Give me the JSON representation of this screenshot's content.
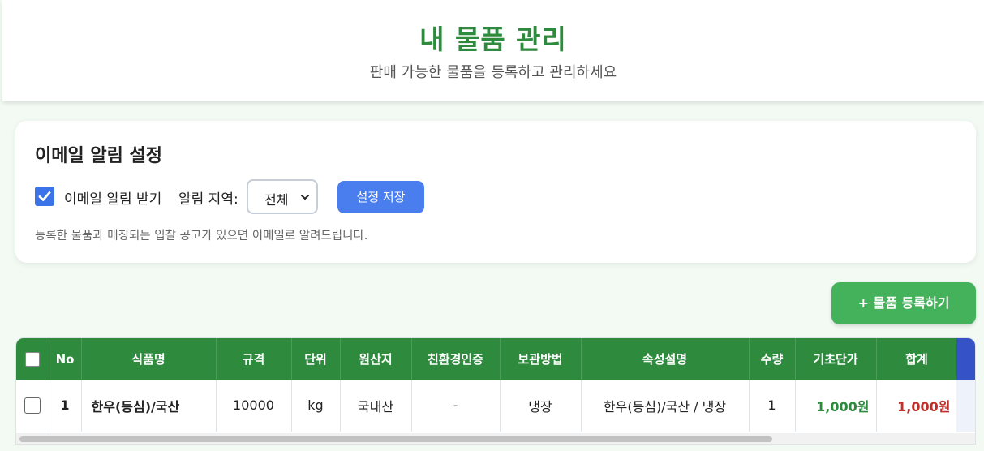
{
  "header": {
    "title": "내 물품 관리",
    "subtitle": "판매 가능한 물품을 등록하고 관리하세요"
  },
  "email_settings": {
    "title": "이메일 알림 설정",
    "receive_label": "이메일 알림 받기",
    "receive_checked": true,
    "region_label": "알림 지역:",
    "region_value": "전체",
    "save_label": "설정 저장",
    "hint": "등록한 물품과 매칭되는 입찰 공고가 있으면 이메일로 알려드립니다."
  },
  "add_button_label": "+ 물품 등록하기",
  "table": {
    "columns": [
      "No",
      "식품명",
      "규격",
      "단위",
      "원산지",
      "친환경인증",
      "보관방법",
      "속성설명",
      "수량",
      "기초단가",
      "합계"
    ],
    "rows": [
      {
        "no": "1",
        "name": "한우(등심)/국산",
        "spec": "10000",
        "unit": "kg",
        "origin": "국내산",
        "eco_cert": "-",
        "storage": "냉장",
        "description": "한우(등심)/국산 / 냉장",
        "quantity": "1",
        "unit_price": "1,000원",
        "total": "1,000원"
      }
    ]
  },
  "colors": {
    "brand_green": "#2e8b3e",
    "accent_blue": "#4a7eef",
    "add_button_green": "#43b25a",
    "total_red": "#c0302a"
  }
}
